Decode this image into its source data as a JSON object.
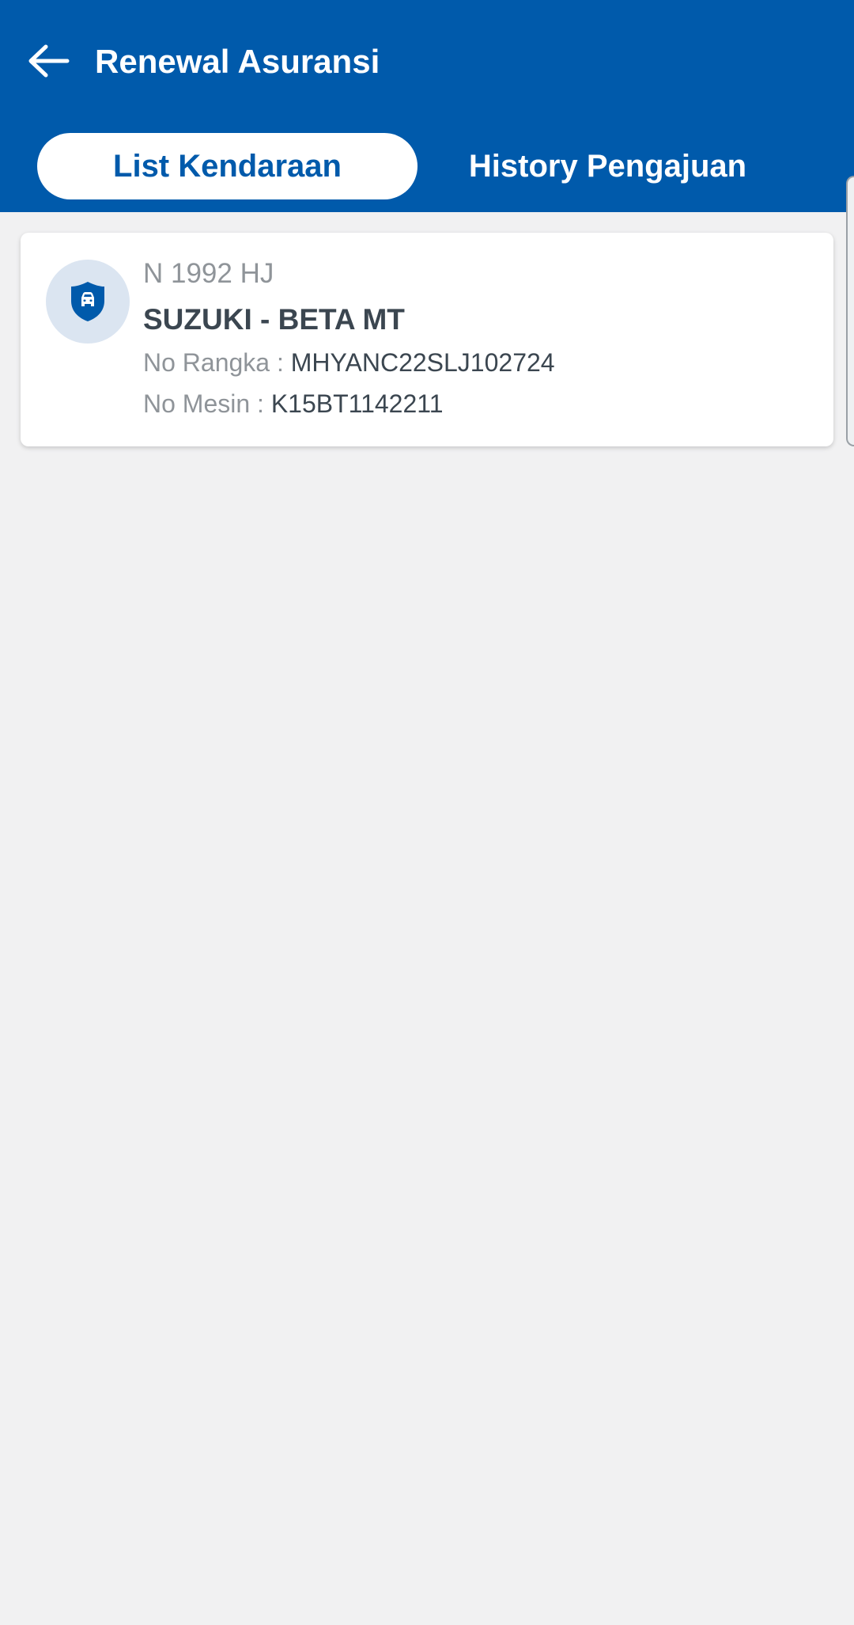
{
  "header": {
    "title": "Renewal Asuransi",
    "back_icon": "arrow-left-icon",
    "background": "#005aab"
  },
  "tabs": [
    {
      "label": "List Kendaraan",
      "active": true
    },
    {
      "label": "History Pengajuan",
      "active": false
    }
  ],
  "vehicles": [
    {
      "icon": "car-shield-icon",
      "plate": "N 1992 HJ",
      "model": "SUZUKI - BETA MT",
      "chassis_label": "No Rangka :",
      "chassis_value": "MHYANC22SLJ102724",
      "engine_label": "No Mesin :",
      "engine_value": "K15BT1142211"
    }
  ],
  "colors": {
    "primary": "#005aab",
    "background": "#f1f1f2",
    "text_dark": "#3b4650",
    "text_muted": "#8f9499"
  }
}
